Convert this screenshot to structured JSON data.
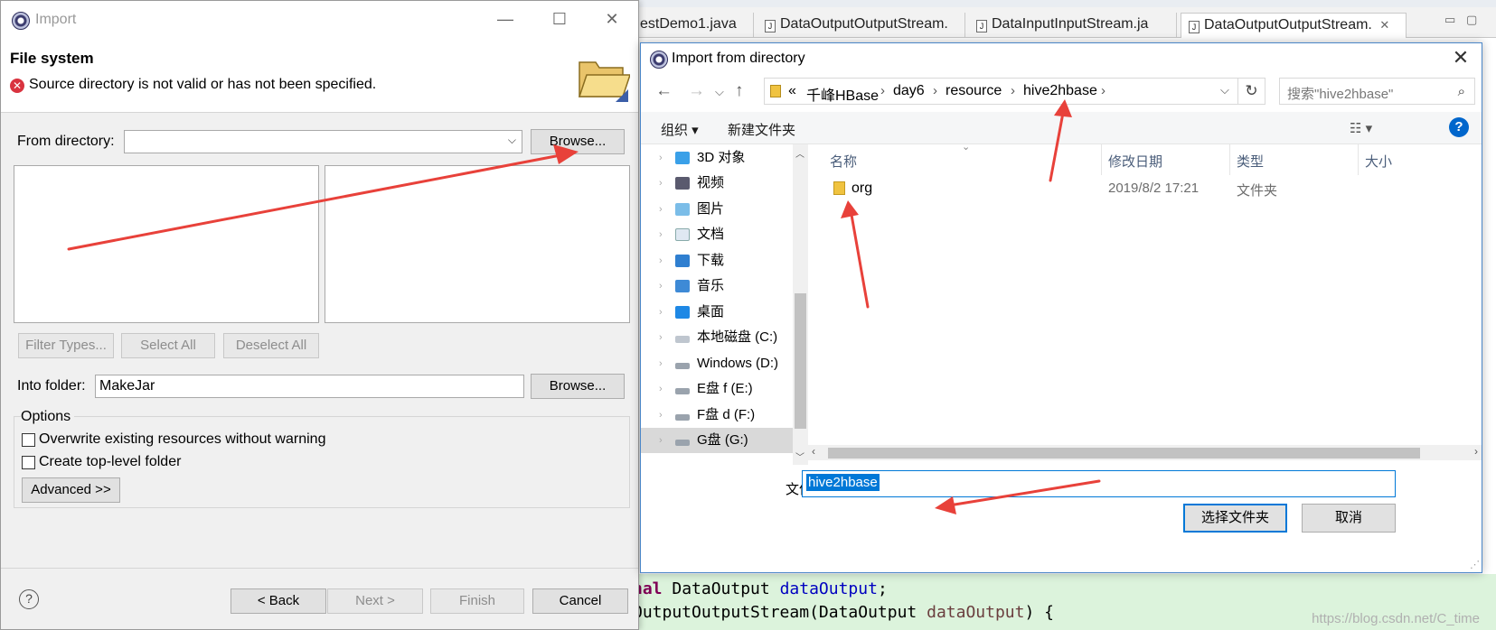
{
  "editor": {
    "tabs": [
      {
        "label": "estDemo1.java",
        "active": false
      },
      {
        "label": "DataOutputOutputStream.",
        "active": false
      },
      {
        "label": "DataInputInputStream.ja",
        "active": false
      },
      {
        "label": "DataOutputOutputStream.",
        "active": true
      }
    ],
    "code_line1": {
      "a": "nal",
      "b": " DataOutput ",
      "c": "dataOutput",
      "d": ";"
    },
    "code_line2": {
      "a": "OutputOutputStream(DataOutput ",
      "b": "dataOutput",
      "c": ") {"
    },
    "watermark": "https://blog.csdn.net/C_time"
  },
  "import_wizard": {
    "title": "Import",
    "page_title": "File system",
    "error_message": "Source directory is not valid or has not been specified.",
    "from_directory_label": "From directory:",
    "from_directory_value": "",
    "browse_label": "Browse...",
    "filter_types_label": "Filter Types...",
    "select_all_label": "Select All",
    "deselect_all_label": "Deselect All",
    "into_folder_label": "Into folder:",
    "into_folder_value": "MakeJar",
    "options_label": "Options",
    "overwrite_label": "Overwrite existing resources without warning",
    "create_top_level_label": "Create top-level folder",
    "advanced_label": "Advanced >>",
    "back_label": "< Back",
    "next_label": "Next >",
    "finish_label": "Finish",
    "cancel_label": "Cancel",
    "help_glyph": "?"
  },
  "browse_dialog": {
    "title": "Import from directory",
    "breadcrumbs": [
      "千峰HBase",
      "day6",
      "resource",
      "hive2hbase"
    ],
    "breadcrumb_prefix": "«",
    "search_placeholder": "搜索\"hive2hbase\"",
    "toolbar": {
      "organize": "组织 ▾",
      "new_folder": "新建文件夹"
    },
    "nav_items": [
      {
        "label": "3D 对象",
        "icon": "3d-objects-icon",
        "selected": false
      },
      {
        "label": "视频",
        "icon": "videos-icon",
        "selected": false
      },
      {
        "label": "图片",
        "icon": "pictures-icon",
        "selected": false
      },
      {
        "label": "文档",
        "icon": "documents-icon",
        "selected": false
      },
      {
        "label": "下载",
        "icon": "downloads-icon",
        "selected": false
      },
      {
        "label": "音乐",
        "icon": "music-icon",
        "selected": false
      },
      {
        "label": "桌面",
        "icon": "desktop-icon",
        "selected": false
      },
      {
        "label": "本地磁盘 (C:)",
        "icon": "system-drive-icon",
        "selected": false
      },
      {
        "label": "Windows (D:)",
        "icon": "drive-icon",
        "selected": false
      },
      {
        "label": "E盘 f (E:)",
        "icon": "drive-icon",
        "selected": false
      },
      {
        "label": "F盘 d (F:)",
        "icon": "drive-icon",
        "selected": false
      },
      {
        "label": "G盘 (G:)",
        "icon": "drive-icon",
        "selected": true
      }
    ],
    "columns": {
      "name": "名称",
      "modified": "修改日期",
      "type": "类型",
      "size": "大小"
    },
    "files": [
      {
        "name": "org",
        "modified": "2019/8/2 17:21",
        "type": "文件夹",
        "size": ""
      }
    ],
    "folder_label": "文件夹:",
    "folder_value": "hive2hbase",
    "select_folder_label": "选择文件夹",
    "cancel_label": "取消"
  },
  "colors": {
    "arrow": "#e8413a",
    "accent": "#0078d7",
    "error": "#d9333f"
  }
}
